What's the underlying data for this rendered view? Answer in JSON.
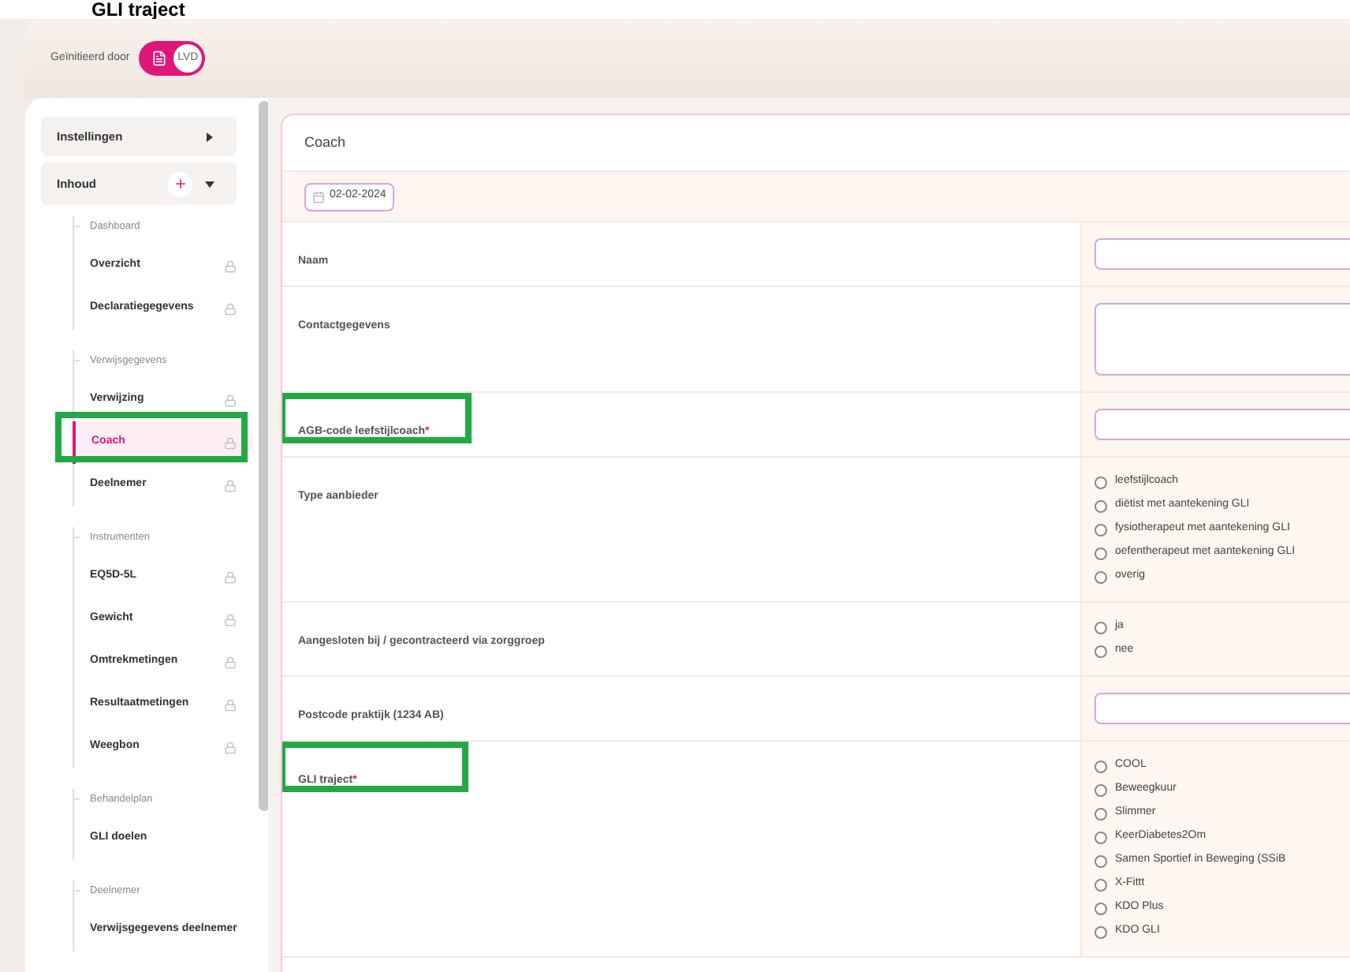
{
  "page_title": "GLI traject",
  "header": {
    "initiated_label": "Geïnitieerd door",
    "toggle": {
      "label": "LVD",
      "on": true
    }
  },
  "sidebar": {
    "buttons": [
      {
        "label": "Instellingen",
        "kind": "expand"
      },
      {
        "label": "Inhoud",
        "kind": "add"
      }
    ],
    "groups": [
      {
        "title": "Dashboard",
        "items": [
          {
            "label": "Overzicht",
            "locked": true,
            "selected": false,
            "highlighted": false
          },
          {
            "label": "Declaratiegegevens",
            "locked": true,
            "selected": false,
            "highlighted": false
          }
        ]
      },
      {
        "title": "Verwijsgegevens",
        "items": [
          {
            "label": "Verwijzing",
            "locked": true,
            "selected": false,
            "highlighted": false
          },
          {
            "label": "Coach",
            "locked": true,
            "selected": true,
            "highlighted": true
          },
          {
            "label": "Deelnemer",
            "locked": true,
            "selected": false,
            "highlighted": false
          }
        ]
      },
      {
        "title": "Instrumenten",
        "items": [
          {
            "label": "EQ5D-5L",
            "locked": true,
            "selected": false,
            "highlighted": false
          },
          {
            "label": "Gewicht",
            "locked": true,
            "selected": false,
            "highlighted": false
          },
          {
            "label": "Omtrekmetingen",
            "locked": true,
            "selected": false,
            "highlighted": false
          },
          {
            "label": "Resultaatmetingen",
            "locked": true,
            "selected": false,
            "highlighted": false
          },
          {
            "label": "Weegbon",
            "locked": true,
            "selected": false,
            "highlighted": false
          }
        ]
      },
      {
        "title": "Behandelplan",
        "items": [
          {
            "label": "GLI doelen",
            "locked": false,
            "selected": false,
            "highlighted": false
          }
        ]
      },
      {
        "title": "Deelnemer",
        "items": [
          {
            "label": "Verwijsgegevens deelnemer",
            "locked": false,
            "selected": false,
            "highlighted": false
          }
        ]
      }
    ]
  },
  "form": {
    "title": "Coach",
    "date": "02-02-2024",
    "fields": [
      {
        "label": "Naam",
        "kind": "input",
        "highlighted": false
      },
      {
        "label": "Contactgegevens",
        "kind": "textarea",
        "highlighted": false
      },
      {
        "label": "AGB-code leefstijlcoach",
        "required_mark": "*",
        "kind": "input",
        "highlighted": true
      },
      {
        "label": "Type aanbieder",
        "kind": "radio",
        "highlighted": false,
        "options": [
          {
            "label": "leefstijlcoach",
            "selected": false
          },
          {
            "label": "diëtist met aantekening GLI",
            "selected": false
          },
          {
            "label": "fysiotherapeut met aantekening GLI",
            "selected": false
          },
          {
            "label": "oefentherapeut met aantekening GLI",
            "selected": false
          },
          {
            "label": "overig",
            "selected": false
          }
        ]
      },
      {
        "label": "Aangesloten bij / gecontracteerd via zorggroep",
        "kind": "radio",
        "highlighted": false,
        "options": [
          {
            "label": "ja",
            "selected": false
          },
          {
            "label": "nee",
            "selected": false
          }
        ]
      },
      {
        "label": "Postcode praktijk (1234 AB)",
        "kind": "input",
        "highlighted": false
      },
      {
        "label": "GLI traject",
        "required_mark": "*",
        "kind": "radio",
        "highlighted": true,
        "options": [
          {
            "label": "COOL",
            "selected": false
          },
          {
            "label": "Beweegkuur",
            "selected": false
          },
          {
            "label": "Slimmer",
            "selected": false
          },
          {
            "label": "KeerDiabetes2Om",
            "selected": false
          },
          {
            "label": "Samen Sportief in Beweging (SSiB",
            "selected": false
          },
          {
            "label": "X-Fittt",
            "selected": false
          },
          {
            "label": "KDO Plus",
            "selected": false
          },
          {
            "label": "KDO GLI",
            "selected": false
          }
        ]
      }
    ]
  }
}
